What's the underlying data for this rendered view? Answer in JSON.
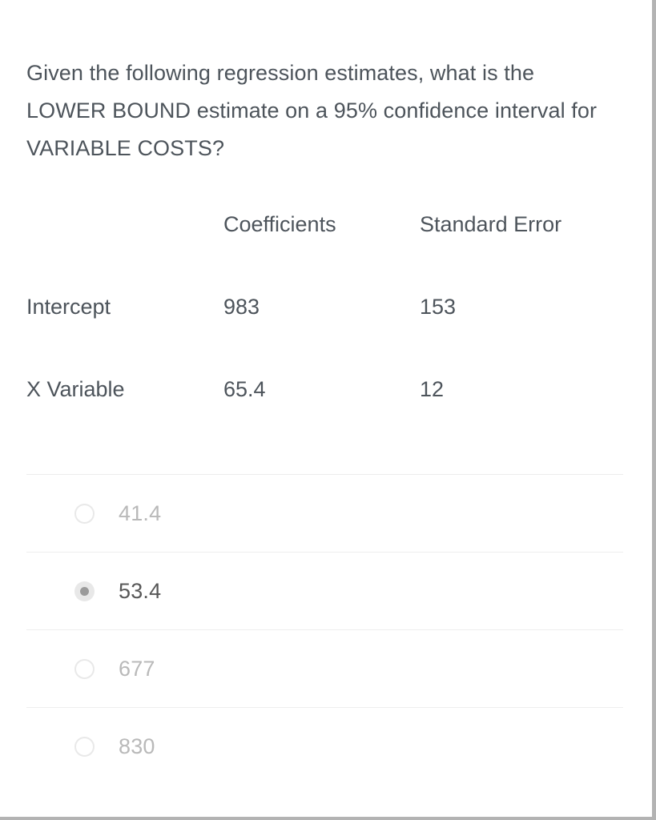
{
  "question": {
    "text": "Given the following regression estimates, what is the LOWER BOUND estimate on a 95% confidence interval for VARIABLE COSTS?"
  },
  "table": {
    "headers": [
      "",
      "Coefficients",
      "Standard Error"
    ],
    "rows": [
      {
        "label": "Intercept",
        "coefficient": "983",
        "standard_error": "153"
      },
      {
        "label": "X Variable",
        "coefficient": "65.4",
        "standard_error": "12"
      }
    ]
  },
  "answers": {
    "options": [
      {
        "label": "41.4",
        "selected": false
      },
      {
        "label": "53.4",
        "selected": true
      },
      {
        "label": "677",
        "selected": false
      },
      {
        "label": "830",
        "selected": false
      }
    ]
  },
  "colors": {
    "text": "#4d545b",
    "option_text_unselected": "#b9b9b9",
    "option_text_selected": "#575757",
    "divider": "#eeeeee",
    "radio_fill_selected": "#e8e8e8",
    "radio_dot_selected": "#9b9b9b",
    "background": "#ffffff",
    "page_border": "#b3b3b3"
  }
}
